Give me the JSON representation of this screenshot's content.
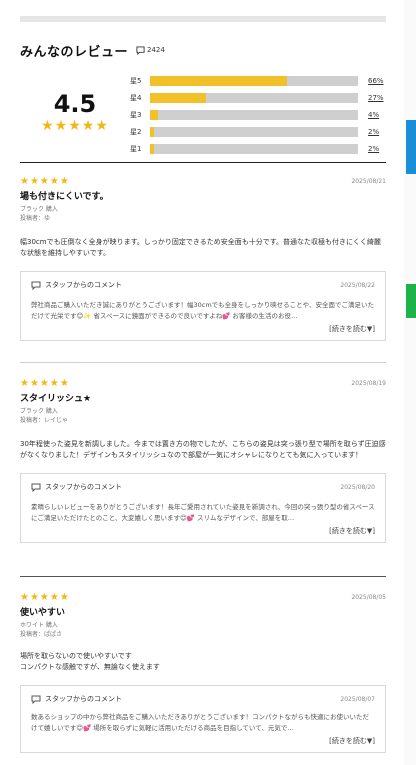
{
  "header": {
    "title": "みんなのレビュー",
    "count": "2424"
  },
  "summary": {
    "average": "4.5",
    "stars": "★★★★★",
    "rows": [
      {
        "label": "星5",
        "pct": "66%",
        "value": 0.66
      },
      {
        "label": "星4",
        "pct": "27%",
        "value": 0.27
      },
      {
        "label": "星3",
        "pct": "4%",
        "value": 0.04
      },
      {
        "label": "星2",
        "pct": "2%",
        "value": 0.02
      },
      {
        "label": "星1",
        "pct": "2%",
        "value": 0.02
      }
    ]
  },
  "reviews": [
    {
      "stars": "★★★★★",
      "date": "2025/08/21",
      "title": "場も付きにくいです。",
      "variant": "ブラック 購入",
      "nickname": "投稿者：ゆ",
      "body": "幅30cmでも圧倒なく全身が映ります。しっかり固定できるため安全面も十分です。普通なた収極も付きにくく綺麗な状態を維持しやすいです。",
      "staff": {
        "label": "スタッフからのコメント",
        "date": "2025/08/22",
        "body": "弊社商品ご購入いただき誠にありがとうございます！幅30cmでも全身をしっかり映せることや、安全面でご満足いただけて光栄です😊✨ 省スペースに鏡面ができるので良いですよね💕 お客様の生活のお役…",
        "more": "[続きを読む▼]"
      }
    },
    {
      "stars": "★★★★★",
      "date": "2025/08/19",
      "title": "スタイリッシュ★",
      "variant": "ブラック 購入",
      "nickname": "投稿者：レイじゃ",
      "body": "30年程使った姿見を新調しました。今までは置き方の物でしたが、こちらの姿見は突っ張り型で場所を取らず圧迫感がなくなりました！デザインもスタイリッシュなので部屋が一気にオシャレになりとても気に入っています！",
      "staff": {
        "label": "スタッフからのコメント",
        "date": "2025/08/20",
        "body": "素晴らしいレビューをありがとうございます！長年ご愛用されていた姿見を新調され、今回の突っ張り型の省スペースにご満足いただけたとのこと、大変嬉しく思います😊💕 スリムなデザインで、部屋を取…",
        "more": "[続きを読む▼]"
      }
    },
    {
      "stars": "★★★★★",
      "date": "2025/08/05",
      "title": "使いやすい",
      "variant": "ホワイト 購入",
      "nickname": "投稿者：ぱぱさ",
      "body": "場所を取らないので使いやすいです\nコンパクトな感触ですが、無論なく使えます",
      "staff": {
        "label": "スタッフからのコメント",
        "date": "2025/08/07",
        "body": "数あるショップの中から弊社商品をご購入いただきありがとうございます！コンパクトながらも快適にお使いいただけて嬉しいです😊💕 場所を取らずに気軽に活用いただける商品を目指していて、元気で…",
        "more": "[続きを読む▼]"
      }
    }
  ],
  "colors": {
    "star": "#f2b711",
    "bar_fill": "#f2c12a",
    "bar_track": "#cfcfcf"
  }
}
